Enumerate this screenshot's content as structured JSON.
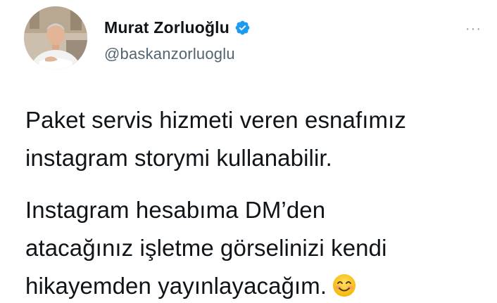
{
  "author": {
    "display_name": "Murat Zorluoğlu",
    "handle": "@baskanzorluoglu",
    "verified_icon": "verified-badge-icon",
    "badge_color": "#1d9bf0"
  },
  "more_menu": {
    "icon": "more-dots-icon",
    "label": "···"
  },
  "tweet_text": {
    "paragraph1": {
      "line1": "Paket servis hizmeti veren esnafımız",
      "line2": "instagram storymi kullanabilir."
    },
    "paragraph2": {
      "line1": "Instagram hesabıma DM’den",
      "line2": "atacağınız işletme görselinizi kendi",
      "line3": "hikayemden yayınlayacağım.",
      "emoji": "smiling-face-emoji"
    }
  }
}
